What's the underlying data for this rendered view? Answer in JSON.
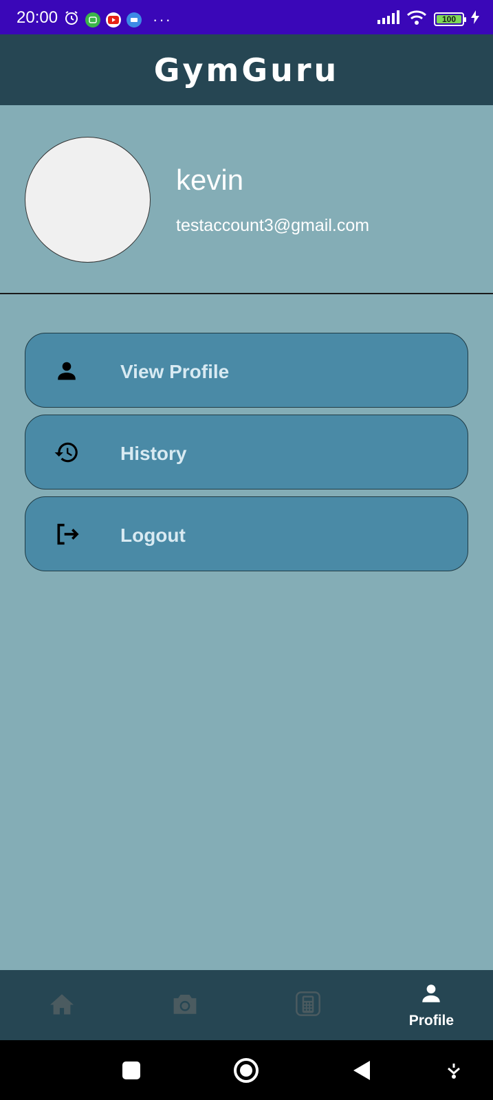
{
  "status_bar": {
    "time": "20:00",
    "battery": "100",
    "icons": [
      "alarm-icon",
      "green-app-icon",
      "youtube-icon",
      "novel-app-icon",
      "more-dots-icon",
      "signal-icon",
      "wifi-icon",
      "battery-icon",
      "charging-icon"
    ]
  },
  "header": {
    "title": "GymGuru"
  },
  "profile": {
    "name": "kevin",
    "email": "testaccount3@gmail.com"
  },
  "menu": {
    "items": [
      {
        "label": "View Profile",
        "icon": "person-icon"
      },
      {
        "label": "History",
        "icon": "history-icon"
      },
      {
        "label": "Logout",
        "icon": "logout-icon"
      }
    ]
  },
  "bottom_nav": {
    "items": [
      {
        "icon": "home-icon",
        "label": ""
      },
      {
        "icon": "camera-icon",
        "label": ""
      },
      {
        "icon": "calculator-icon",
        "label": ""
      },
      {
        "icon": "profile-icon",
        "label": "Profile"
      }
    ],
    "active": "Profile"
  },
  "colors": {
    "status_bar": "#3a07b8",
    "header": "#264653",
    "background": "#84adb6",
    "menu_item": "#4a8aa6",
    "inactive_nav_icon": "#4b5b60"
  }
}
